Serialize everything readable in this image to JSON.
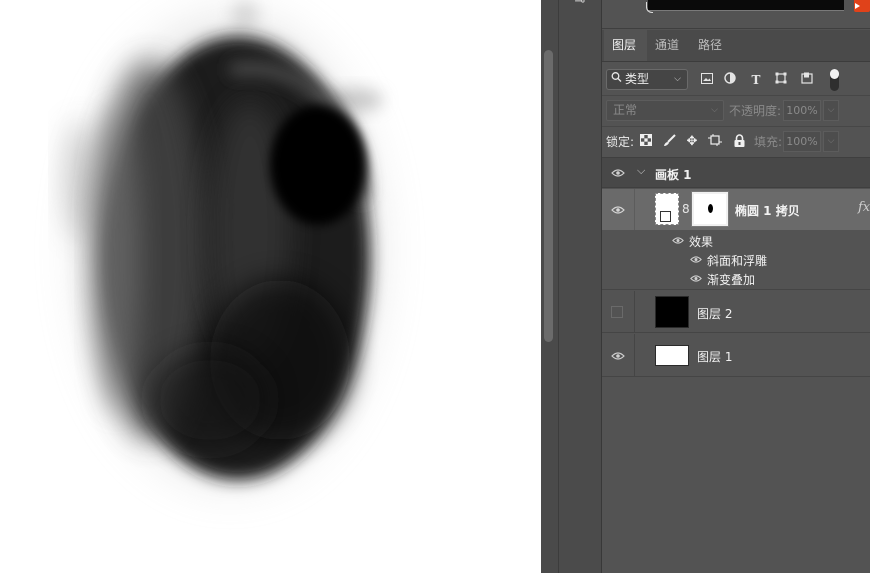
{
  "panel": {
    "tabs": [
      {
        "label": "图层",
        "active": true
      },
      {
        "label": "通道",
        "active": false
      },
      {
        "label": "路径",
        "active": false
      }
    ],
    "filter": {
      "label": "类型",
      "icons": [
        "image-filter-icon",
        "adjustment-filter-icon",
        "type-filter-icon",
        "shape-filter-icon",
        "smart-object-filter-icon"
      ]
    },
    "blend": {
      "mode": "正常",
      "opacity_label": "不透明度:",
      "opacity_value": "100%"
    },
    "lock": {
      "label": "锁定:",
      "fill_label": "填充:",
      "fill_value": "100%"
    },
    "layers": {
      "group_name": "画板 1",
      "ellipse_layer": "椭圆 1 拷贝",
      "fx_label": "fx",
      "effects_label": "效果",
      "effect_items": [
        "斜面和浮雕",
        "渐变叠加"
      ],
      "layer2": "图层 2",
      "layer1": "图层 1"
    },
    "colors": {
      "panel_bg": "#535353",
      "selected_row": "#6a6a6a",
      "accent_swatch": "#e0421a"
    }
  }
}
